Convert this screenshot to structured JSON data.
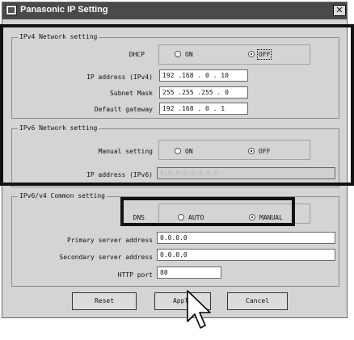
{
  "window": {
    "title": "Panasonic IP Setting",
    "close_glyph": "✕",
    "app_icon": "network-window-icon"
  },
  "ipv4": {
    "legend": "IPv4 Network setting",
    "dhcp_label": "DHCP",
    "dhcp_on": "ON",
    "dhcp_off": "OFF",
    "dhcp_selected": "OFF",
    "ip_label": "IP address (IPv4)",
    "ip_value": "192 .168 . 0 . 10",
    "subnet_label": "Subnet Mask",
    "subnet_value": "255 .255 .255 . 0",
    "gateway_label": "Default gateway",
    "gateway_value": "192 .168 . 0 . 1"
  },
  "ipv6": {
    "legend": "IPv6 Network setting",
    "manual_label": "Manual setting",
    "manual_on": "ON",
    "manual_off": "OFF",
    "manual_selected": "OFF",
    "ip_label": "IP address (IPv6)",
    "ip_value": "0:0:0:0:0:0:0:0"
  },
  "common": {
    "legend": "IPv6/v4 Common setting",
    "dns_label": "DNS",
    "dns_auto": "AUTO",
    "dns_manual": "MANUAL",
    "dns_selected": "MANUAL",
    "primary_label": "Primary server address",
    "primary_value": "0.0.0.0",
    "secondary_label": "Secondary server address",
    "secondary_value": "0.0.0.0",
    "http_label": "HTTP port",
    "http_value": "80"
  },
  "buttons": {
    "reset": "Reset",
    "apply": "Apply",
    "cancel": "Cancel"
  },
  "colors": {
    "titlebar": "#4a4a4a",
    "window_bg": "#d4d4d4",
    "highlight": "#111111"
  }
}
